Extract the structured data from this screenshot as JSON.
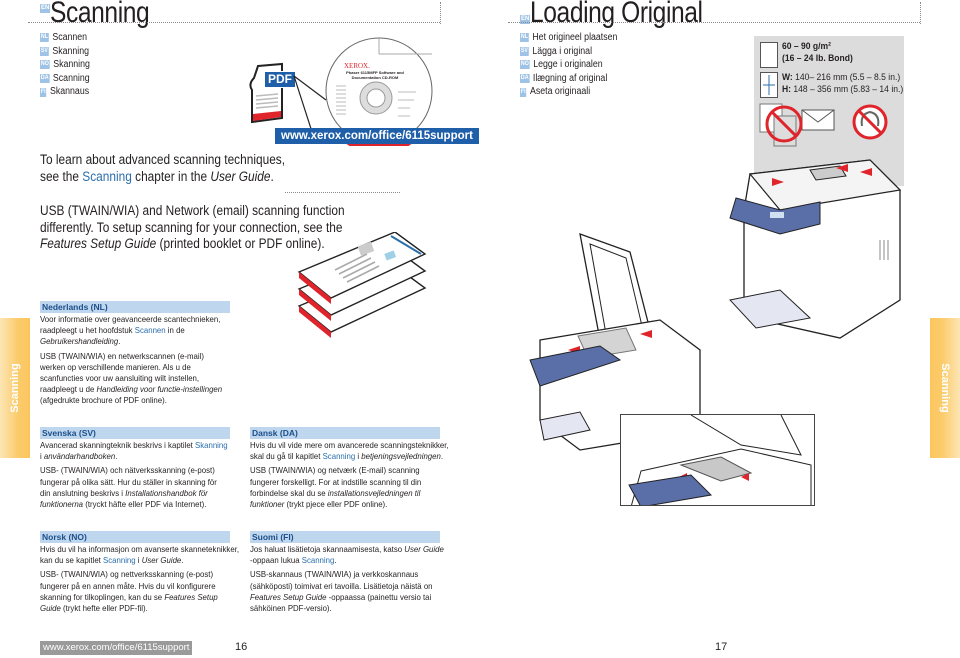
{
  "left_page": {
    "lang_code": "EN",
    "title": "Scanning",
    "translations": [
      {
        "code": "NL",
        "text": "Scannen"
      },
      {
        "code": "SV",
        "text": "Skanning"
      },
      {
        "code": "NO",
        "text": "Skanning"
      },
      {
        "code": "DA",
        "text": "Scanning"
      },
      {
        "code": "FI",
        "text": "Skannaus"
      }
    ],
    "pdf_label": "PDF",
    "cd": {
      "brand": "XEROX.",
      "title_line1": "Phaser 6115MFP Software and",
      "title_line2": "Documentation CD-ROM"
    },
    "support_url": "www.xerox.com/office/6115support",
    "intro": {
      "line1": "To learn about advanced scanning techniques,",
      "line2_pre": "see the ",
      "line2_link": "Scanning",
      "line2_mid": " chapter in the ",
      "line2_italic": "User Guide",
      "line2_post": "."
    },
    "usb_note": {
      "line1": "USB (TWAIN/WIA) and Network (email) scanning function",
      "line2": "differently. To setup scanning for your connection, see the",
      "line3_italic": "Features Setup Guide",
      "line3_post": " (printed booklet or PDF online)."
    },
    "side_tab": "Scanning",
    "boxes": {
      "nl": {
        "header": "Nederlands (NL)",
        "p1_l1": "Voor informatie over geavanceerde scantechnieken,",
        "p1_l2_pre": "raadpleegt u het hoofdstuk ",
        "p1_l2_link": "Scannen",
        "p1_l2_post": " in de",
        "p1_l3_italic": "Gebruikershandleiding",
        "p1_l3_post": ".",
        "p2_l1": "USB (TWAIN/WIA) en netwerkscannen (e-mail)",
        "p2_l2": "werken op verschillende manieren. Als u de",
        "p2_l3": "scanfuncties voor uw aansluiting wilt instellen,",
        "p2_l4_pre": "raadpleegt u de ",
        "p2_l4_italic": "Handleiding voor functie-instellingen",
        "p2_l5": "(afgedrukte brochure of PDF online)."
      },
      "sv": {
        "header": "Svenska (SV)",
        "p1_l1_pre": "Avancerad skanningteknik beskrivs i kaptilet ",
        "p1_l1_link": "Skanning",
        "p1_l2_pre": "i ",
        "p1_l2_italic": "användarhandboken",
        "p1_l2_post": ".",
        "p2_l1": "USB- (TWAIN/WIA) och nätverksskanning (e-post)",
        "p2_l2": "fungerar på olika sätt. Hur du ställer in skanning för",
        "p2_l3_pre": "din anslutning beskrivs i ",
        "p2_l3_italic": "Installationshandbok för",
        "p2_l4_italic": "funktionerna",
        "p2_l4_post": " (tryckt häfte eller PDF via Internet)."
      },
      "da": {
        "header": "Dansk (DA)",
        "p1_l1": "Hvis du vil vide mere om avancerede scanningsteknikker,",
        "p1_l2_pre": "skal du gå til kapitlet ",
        "p1_l2_link": "Scanning",
        "p1_l2_mid": " i ",
        "p1_l2_italic": "betjeningsvejledningen",
        "p1_l2_post": ".",
        "p2_l1": "USB (TWAIN/WIA) og netværk (E-mail) scanning",
        "p2_l2": "fungerer forskelligt. For at indstille scanning til din",
        "p2_l3_pre": "forbindelse skal du se ",
        "p2_l3_italic": "installationsvejledningen til",
        "p2_l4_italic": "funktioner",
        "p2_l4_post": " (trykt pjece eller PDF online)."
      },
      "no": {
        "header": "Norsk (NO)",
        "p1_l1": "Hvis du vil ha informasjon om avanserte skanneteknikker,",
        "p1_l2_pre": "kan du se kapitlet ",
        "p1_l2_link": "Scanning",
        "p1_l2_mid": " i ",
        "p1_l2_italic": "User Guide",
        "p1_l2_post": ".",
        "p2_l1": "USB- (TWAIN/WIA) og nettverksskanning (e-post)",
        "p2_l2": "fungerer på en annen måte. Hvis du vil konfigurere",
        "p2_l3_pre": "skanning for tilkoplingen, kan du se ",
        "p2_l3_italic": "Features Setup",
        "p2_l4_italic": "Guide",
        "p2_l4_post": " (trykt hefte eller PDF-fil)."
      },
      "fi": {
        "header": "Suomi (FI)",
        "p1_l1_pre": "Jos haluat lisätietoja skannaamisesta, katso ",
        "p1_l1_italic": "User Guide",
        "p1_l2_pre": "-oppaan lukua ",
        "p1_l2_link": "Scanning",
        "p1_l2_post": ".",
        "p2_l1": "USB-skannaus (TWAIN/WIA) ja verkkoskannaus",
        "p2_l2": "(sähköposti) toimivat eri tavoilla. Lisätietoja näistä on",
        "p2_l3_italic": "Features Setup Guide",
        "p2_l3_post": " -oppaassa (painettu versio tai",
        "p2_l4": "sähköinen PDF-versio)."
      }
    },
    "footer_url": "www.xerox.com/office/6115support",
    "page_number": "16"
  },
  "right_page": {
    "lang_code": "EN",
    "title": "Loading Original",
    "translations": [
      {
        "code": "NL",
        "text": "Het origineel plaatsen"
      },
      {
        "code": "SV",
        "text": "Lägga i original"
      },
      {
        "code": "NO",
        "text": "Legge i originalen"
      },
      {
        "code": "DA",
        "text": "Ilægning af original"
      },
      {
        "code": "FI",
        "text": "Aseta originaali"
      }
    ],
    "paper_spec": {
      "weight_line1": "60 – 90 g/m²",
      "weight_line2": "(16 – 24 lb. Bond)",
      "width_label": "W:",
      "width_value": "140– 216 mm (5.5 – 8.5 in.)",
      "height_label": "H:",
      "height_value": "148 – 356 mm (5.83 – 14 in.)"
    },
    "side_tab": "Scanning",
    "page_number": "17"
  },
  "colors": {
    "accent_blue": "#1f5ea8",
    "link_blue": "#2b6fad",
    "box_header_bg": "#bed6ee",
    "tab_orange": "#fbc65f",
    "warning_red": "#e0242b"
  }
}
